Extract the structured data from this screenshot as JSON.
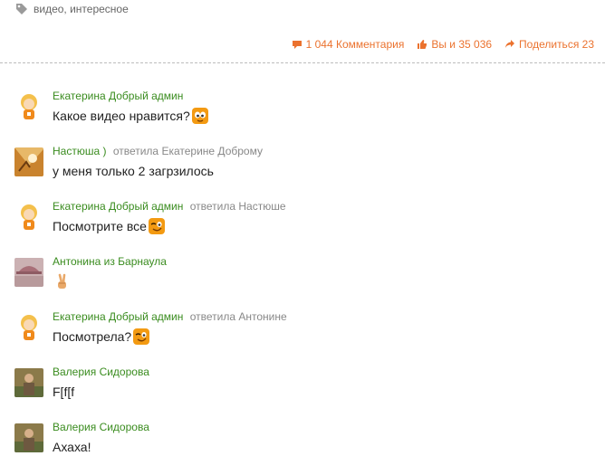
{
  "tags": {
    "text": "видео, интересное"
  },
  "actions": {
    "comments": "1 044 Комментария",
    "likes": "Вы и 35 036",
    "share": "Поделиться 23"
  },
  "comments": [
    {
      "author": "Екатерина Добрый админ",
      "reply_word": "",
      "reply_to": "",
      "text": "Какое видео нравится?",
      "emoji": "eyes-smiley-icon",
      "avatar": "blonde-girl-avatar"
    },
    {
      "author": "Настюша )",
      "reply_word": "ответила",
      "reply_to": "Екатерине Доброму",
      "text": "у меня только 2 загрзилось",
      "emoji": "",
      "avatar": "autumn-photo-avatar"
    },
    {
      "author": "Екатерина Добрый админ",
      "reply_word": "ответила",
      "reply_to": "Настюше",
      "text": "Посмотрите все",
      "emoji": "wink-smiley-icon",
      "avatar": "blonde-girl-avatar"
    },
    {
      "author": "Антонина из Барнаула",
      "reply_word": "",
      "reply_to": "",
      "text": "",
      "emoji": "victory-hand-icon",
      "avatar": "cap-photo-avatar"
    },
    {
      "author": "Екатерина Добрый админ",
      "reply_word": "ответила",
      "reply_to": "Антонине",
      "text": "Посмотрела?",
      "emoji": "wink-smiley-icon",
      "avatar": "blonde-girl-avatar"
    },
    {
      "author": "Валерия Сидорова",
      "reply_word": "",
      "reply_to": "",
      "text": "F[f[f",
      "emoji": "",
      "avatar": "person-photo-avatar"
    },
    {
      "author": "Валерия Сидорова",
      "reply_word": "",
      "reply_to": "",
      "text": "Ахаха!",
      "emoji": "",
      "avatar": "person-photo-avatar"
    }
  ],
  "colors": {
    "accent": "#eb722e",
    "author": "#3a8c1f",
    "muted": "#888888"
  }
}
